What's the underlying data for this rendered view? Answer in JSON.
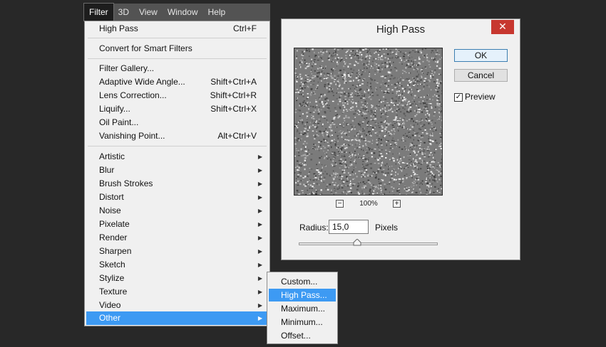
{
  "menubar": {
    "items": [
      {
        "label": "Filter",
        "active": true
      },
      {
        "label": "3D",
        "active": false
      },
      {
        "label": "View",
        "active": false
      },
      {
        "label": "Window",
        "active": false
      },
      {
        "label": "Help",
        "active": false
      }
    ]
  },
  "filter_menu": {
    "last_filter": {
      "label": "High Pass",
      "shortcut": "Ctrl+F"
    },
    "convert_smart": "Convert for Smart Filters",
    "filters": [
      {
        "label": "Filter Gallery...",
        "shortcut": ""
      },
      {
        "label": "Adaptive Wide Angle...",
        "shortcut": "Shift+Ctrl+A"
      },
      {
        "label": "Lens Correction...",
        "shortcut": "Shift+Ctrl+R"
      },
      {
        "label": "Liquify...",
        "shortcut": "Shift+Ctrl+X"
      },
      {
        "label": "Oil Paint...",
        "shortcut": ""
      },
      {
        "label": "Vanishing Point...",
        "shortcut": "Alt+Ctrl+V"
      }
    ],
    "categories": [
      "Artistic",
      "Blur",
      "Brush Strokes",
      "Distort",
      "Noise",
      "Pixelate",
      "Render",
      "Sharpen",
      "Sketch",
      "Stylize",
      "Texture",
      "Video",
      "Other"
    ],
    "highlighted_category": "Other"
  },
  "submenu": {
    "items": [
      "Custom...",
      "High Pass...",
      "Maximum...",
      "Minimum...",
      "Offset..."
    ],
    "highlighted": "High Pass..."
  },
  "dialog": {
    "title": "High Pass",
    "close_glyph": "✕",
    "ok_label": "OK",
    "cancel_label": "Cancel",
    "preview_label": "Preview",
    "preview_checked": true,
    "zoom_level": "100%",
    "zoom_out_glyph": "−",
    "zoom_in_glyph": "+",
    "radius_label": "Radius:",
    "radius_value": "15,0",
    "units_label": "Pixels",
    "slider_fraction": 0.42
  },
  "colors": {
    "highlight": "#3d9af3",
    "background": "#282828",
    "menubar": "#535353",
    "close_button": "#c7372f"
  }
}
